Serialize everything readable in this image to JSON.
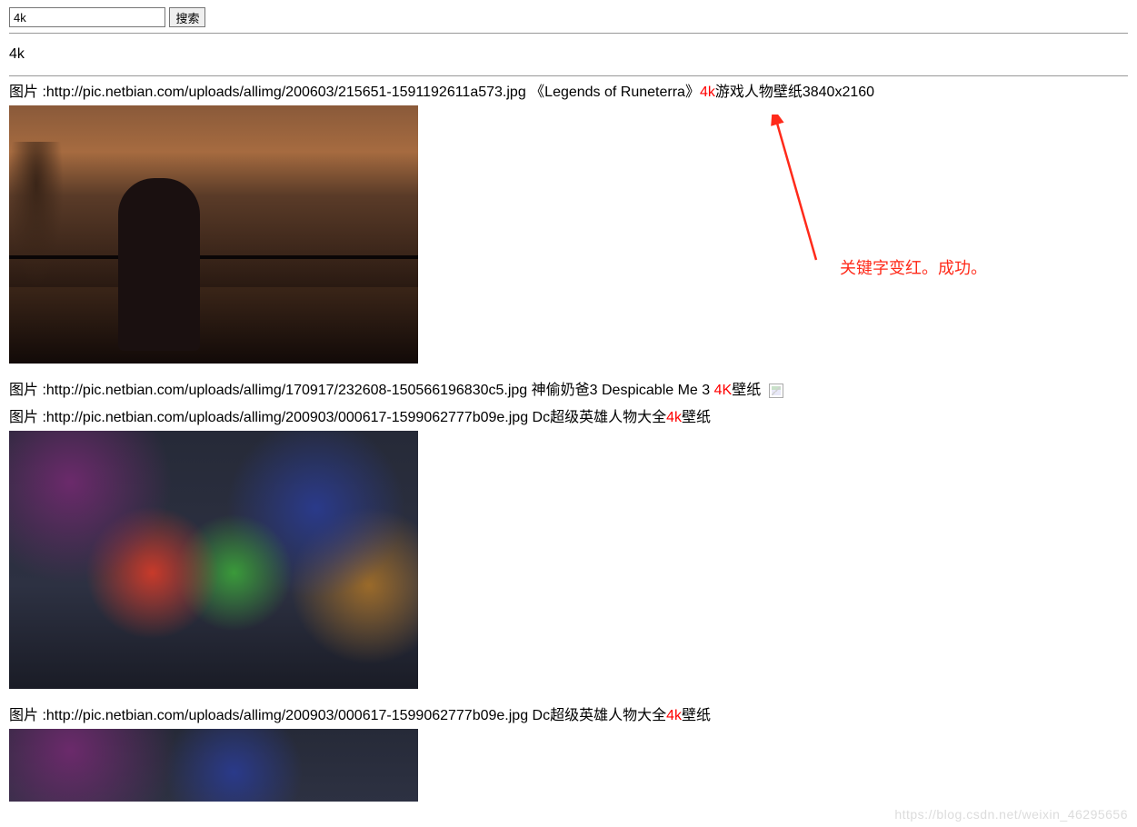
{
  "search": {
    "value": "4k",
    "button_label": "搜索"
  },
  "query_echo": "4k",
  "label_prefix": "图片 :",
  "keyword": "4k",
  "keyword_upper": "4K",
  "results": [
    {
      "url": "http://pic.netbian.com/uploads/allimg/200603/215651-1591192611a573.jpg",
      "title_pre": " 《Legends of Runeterra》",
      "title_post": "游戏人物壁纸3840x2160",
      "kw_variant": "4k",
      "has_image": true,
      "thumb_class": "t1"
    },
    {
      "url": "http://pic.netbian.com/uploads/allimg/170917/232608-150566196830c5.jpg",
      "title_pre": " 神偷奶爸3 Despicable Me 3 ",
      "title_post": "壁纸",
      "kw_variant": "4K",
      "has_image": false
    },
    {
      "url": "http://pic.netbian.com/uploads/allimg/200903/000617-1599062777b09e.jpg",
      "title_pre": " Dc超级英雄人物大全",
      "title_post": "壁纸",
      "kw_variant": "4k",
      "has_image": true,
      "thumb_class": "t3"
    },
    {
      "url": "http://pic.netbian.com/uploads/allimg/200903/000617-1599062777b09e.jpg",
      "title_pre": " Dc超级英雄人物大全",
      "title_post": "壁纸",
      "kw_variant": "4k",
      "has_image": true,
      "thumb_class": "t4"
    }
  ],
  "annotation": {
    "text": "关键字变红。成功。"
  },
  "watermark": "https://blog.csdn.net/weixin_46295656"
}
